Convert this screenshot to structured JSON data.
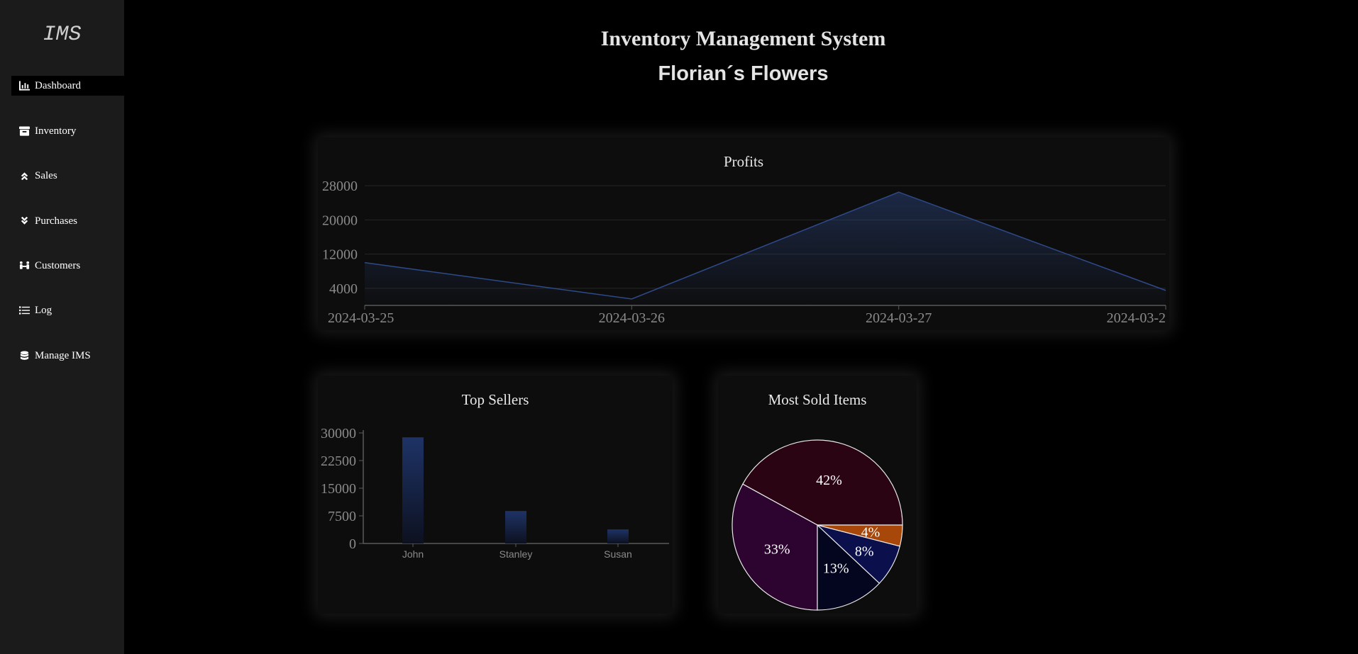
{
  "sidebar": {
    "logo": "IMS",
    "items": [
      {
        "label": "Dashboard",
        "icon": "chart-bar-icon"
      },
      {
        "label": "Inventory",
        "icon": "box-icon"
      },
      {
        "label": "Sales",
        "icon": "double-chevron-up-icon"
      },
      {
        "label": "Purchases",
        "icon": "double-chevron-down-icon"
      },
      {
        "label": "Customers",
        "icon": "people-icon"
      },
      {
        "label": "Log",
        "icon": "list-icon"
      },
      {
        "label": "Manage IMS",
        "icon": "database-icon"
      }
    ]
  },
  "header": {
    "title": "Inventory Management System",
    "subtitle": "Florian´s Flowers"
  },
  "colors": {
    "accent": "#2e4a8a",
    "pie": [
      "#2a0412",
      "#2d0330",
      "#04051e",
      "#0b0f4b",
      "#a8470a"
    ]
  },
  "chart_data": [
    {
      "type": "area",
      "title": "Profits",
      "x": [
        "2024-03-25",
        "2024-03-26",
        "2024-03-27",
        "2024-03-2"
      ],
      "values": [
        10000,
        1500,
        26500,
        3500
      ],
      "yticks": [
        4000,
        12000,
        20000,
        28000
      ],
      "ylim": [
        0,
        31000
      ],
      "grid": true
    },
    {
      "type": "bar",
      "title": "Top Sellers",
      "categories": [
        "John",
        "Stanley",
        "Susan"
      ],
      "values": [
        28800,
        8800,
        3800
      ],
      "yticks": [
        0,
        7500,
        15000,
        22500,
        30000
      ],
      "ylim": [
        0,
        30000
      ]
    },
    {
      "type": "pie",
      "title": "Most Sold Items",
      "values": [
        42,
        33,
        13,
        8,
        4
      ],
      "labels": [
        "42%",
        "33%",
        "13%",
        "8%",
        "4%"
      ]
    }
  ]
}
